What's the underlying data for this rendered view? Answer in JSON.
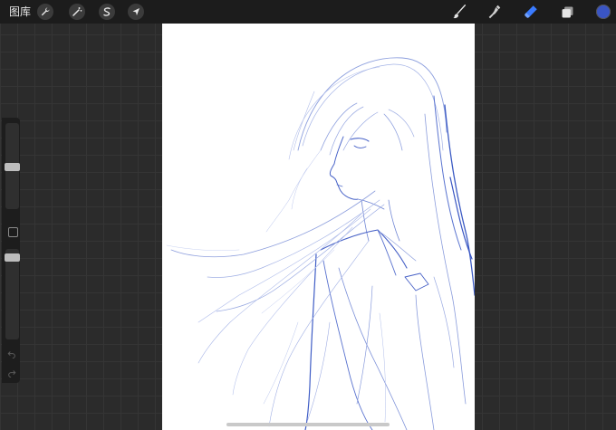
{
  "topbar": {
    "gallery_label": "图库",
    "left_tools": [
      {
        "name": "actions",
        "icon": "wrench-icon"
      },
      {
        "name": "adjustments",
        "icon": "magic-wand-icon"
      },
      {
        "name": "selection",
        "icon": "selection-s-icon"
      },
      {
        "name": "transform",
        "icon": "arrow-cursor-icon"
      }
    ],
    "right_tools": [
      {
        "name": "brush",
        "icon": "brush-icon"
      },
      {
        "name": "smudge",
        "icon": "smudge-finger-icon"
      },
      {
        "name": "eraser",
        "icon": "eraser-icon",
        "active": true
      },
      {
        "name": "layers",
        "icon": "layers-icon"
      }
    ],
    "current_color": "#3a55c4"
  },
  "sidebar": {
    "brush_size_level": 0.5,
    "opacity_level": 0.1,
    "controls": [
      "brush-size-slider",
      "modify-button",
      "opacity-slider",
      "undo-button",
      "redo-button"
    ]
  },
  "colors": {
    "accent": "#3a7bff",
    "sketch_stroke": "#3f5fc8",
    "background": "#2b2b2b"
  }
}
